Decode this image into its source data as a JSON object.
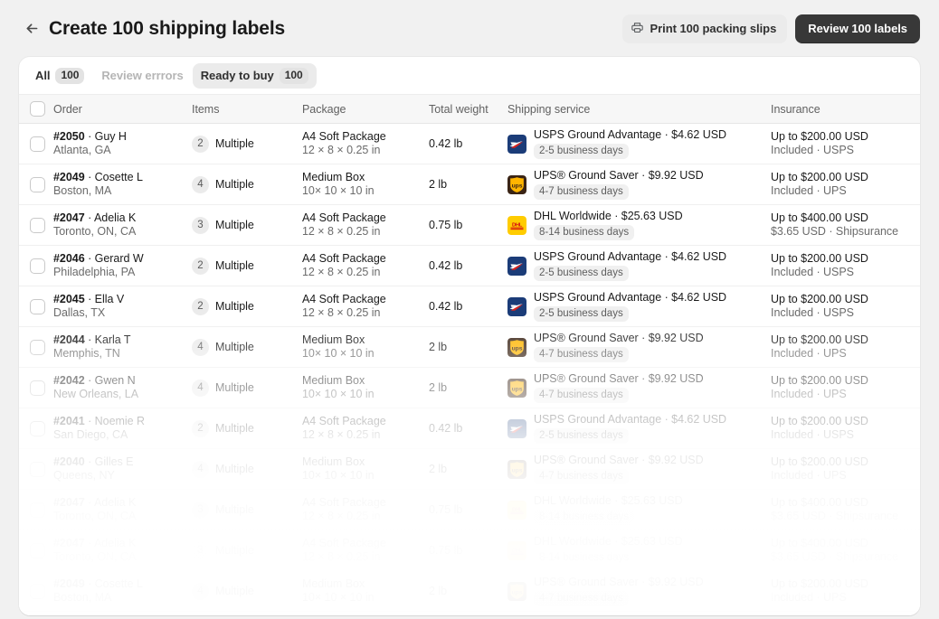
{
  "header": {
    "back_icon": "arrow-left-icon",
    "title": "Create 100 shipping labels",
    "print_label": "Print 100 packing slips",
    "print_icon": "printer-icon",
    "review_label": "Review 100 labels"
  },
  "tabs": [
    {
      "label": "All",
      "count": "100",
      "state": "default"
    },
    {
      "label": "Review errrors",
      "count": "",
      "state": "muted"
    },
    {
      "label": "Ready to buy",
      "count": "100",
      "state": "selected"
    }
  ],
  "table": {
    "columns": {
      "order": "Order",
      "items": "Items",
      "package": "Package",
      "weight": "Total weight",
      "service": "Shipping service",
      "insurance": "Insurance"
    },
    "rows": [
      {
        "order_id": "#2050",
        "customer": "Guy H",
        "location": "Atlanta, GA",
        "items_count": "2",
        "items_label": "Multiple",
        "package_name": "A4 Soft Package",
        "package_dims": "12 × 8 × 0.25 in",
        "weight": "0.42 lb",
        "carrier": "usps",
        "service": "USPS Ground Advantage · $4.62 USD",
        "days": "2-5 business days",
        "insurance_amount": "Up to $200.00 USD",
        "insurance_provider": "Included · USPS",
        "opacity": 1
      },
      {
        "order_id": "#2049",
        "customer": "Cosette L",
        "location": "Boston, MA",
        "items_count": "4",
        "items_label": "Multiple",
        "package_name": "Medium Box",
        "package_dims": "10× 10 × 10 in",
        "weight": "2 lb",
        "carrier": "ups",
        "service": "UPS® Ground Saver · $9.92 USD",
        "days": "4-7 business days",
        "insurance_amount": "Up to $200.00 USD",
        "insurance_provider": "Included · UPS",
        "opacity": 1
      },
      {
        "order_id": "#2047",
        "customer": "Adelia K",
        "location": "Toronto, ON, CA",
        "items_count": "3",
        "items_label": "Multiple",
        "package_name": "A4 Soft Package",
        "package_dims": "12 × 8 × 0.25 in",
        "weight": "0.75 lb",
        "carrier": "dhl",
        "service": "DHL Worldwide · $25.63 USD",
        "days": "8-14 business days",
        "insurance_amount": "Up to $400.00 USD",
        "insurance_provider": "$3.65 USD · Shipsurance",
        "opacity": 1
      },
      {
        "order_id": "#2046",
        "customer": "Gerard W",
        "location": "Philadelphia, PA",
        "items_count": "2",
        "items_label": "Multiple",
        "package_name": "A4 Soft Package",
        "package_dims": "12 × 8 × 0.25 in",
        "weight": "0.42 lb",
        "carrier": "usps",
        "service": "USPS Ground Advantage · $4.62 USD",
        "days": "2-5 business days",
        "insurance_amount": "Up to $200.00 USD",
        "insurance_provider": "Included · USPS",
        "opacity": 1
      },
      {
        "order_id": "#2045",
        "customer": "Ella V",
        "location": "Dallas, TX",
        "items_count": "2",
        "items_label": "Multiple",
        "package_name": "A4 Soft Package",
        "package_dims": "12 × 8 × 0.25 in",
        "weight": "0.42 lb",
        "carrier": "usps",
        "service": "USPS Ground Advantage · $4.62 USD",
        "days": "2-5 business days",
        "insurance_amount": "Up to $200.00 USD",
        "insurance_provider": "Included · USPS",
        "opacity": 1
      },
      {
        "order_id": "#2044",
        "customer": "Karla T",
        "location": "Memphis, TN",
        "items_count": "4",
        "items_label": "Multiple",
        "package_name": "Medium Box",
        "package_dims": "10× 10 × 10 in",
        "weight": "2 lb",
        "carrier": "ups",
        "service": "UPS® Ground Saver · $9.92 USD",
        "days": "4-7 business days",
        "insurance_amount": "Up to $200.00 USD",
        "insurance_provider": "Included · UPS",
        "opacity": 1
      },
      {
        "order_id": "#2042",
        "customer": "Gwen N",
        "location": "New Orleans, LA",
        "items_count": "4",
        "items_label": "Multiple",
        "package_name": "Medium Box",
        "package_dims": "10× 10 × 10 in",
        "weight": "2 lb",
        "carrier": "ups",
        "service": "UPS® Ground Saver · $9.92 USD",
        "days": "4-7 business days",
        "insurance_amount": "Up to $200.00 USD",
        "insurance_provider": "Included · UPS",
        "opacity": 1
      },
      {
        "order_id": "#2041",
        "customer": "Noemie R",
        "location": "San Diego, CA",
        "items_count": "2",
        "items_label": "Multiple",
        "package_name": "A4 Soft Package",
        "package_dims": "12 × 8 × 0.25 in",
        "weight": "0.42 lb",
        "carrier": "usps",
        "service": "USPS Ground Advantage · $4.62 USD",
        "days": "2-5 business days",
        "insurance_amount": "Up to $200.00 USD",
        "insurance_provider": "Included · USPS",
        "opacity": 1
      },
      {
        "order_id": "#2040",
        "customer": "Gilles E",
        "location": "Queens, NY",
        "items_count": "4",
        "items_label": "Multiple",
        "package_name": "Medium Box",
        "package_dims": "10× 10 × 10 in",
        "weight": "2 lb",
        "carrier": "ups",
        "service": "UPS® Ground Saver · $9.92 USD",
        "days": "4-7 business days",
        "insurance_amount": "Up to $200.00 USD",
        "insurance_provider": "Included · UPS",
        "opacity": 1
      },
      {
        "order_id": "#2047",
        "customer": "Adelia K",
        "location": "Toronto, ON, CA",
        "items_count": "3",
        "items_label": "Multiple",
        "package_name": "A4 Soft Package",
        "package_dims": "12 × 8 × 0.25 in",
        "weight": "0.75 lb",
        "carrier": "dhl",
        "service": "DHL Worldwide · $25.63 USD",
        "days": "8-14 business days",
        "insurance_amount": "Up to $400.00 USD",
        "insurance_provider": "$3.65 USD · Shipsurance",
        "opacity": 1
      },
      {
        "order_id": "#2047",
        "customer": "Adelia K",
        "location": "Toronto, ON, CA",
        "items_count": "3",
        "items_label": "Multiple",
        "package_name": "A4 Soft Package",
        "package_dims": "12 × 8 × 0.25 in",
        "weight": "0.75 lb",
        "carrier": "dhl",
        "service": "DHL Worldwide · $25.63 USD",
        "days": "8-14 business days",
        "insurance_amount": "Up to $400.00 USD",
        "insurance_provider": "$3.65 USD · Shipsurance",
        "opacity": 1
      },
      {
        "order_id": "#2049",
        "customer": "Cosette L",
        "location": "Boston, MA",
        "items_count": "4",
        "items_label": "Multiple",
        "package_name": "Medium Box",
        "package_dims": "10× 10 × 10 in",
        "weight": "2 lb",
        "carrier": "ups",
        "service": "UPS® Ground Saver · $9.92 USD",
        "days": "4-7 business days",
        "insurance_amount": "Up to $200.00 USD",
        "insurance_provider": "Included · UPS",
        "opacity": 1
      }
    ]
  },
  "colors": {
    "page_bg": "#f1f1f1",
    "card_bg": "#ffffff",
    "primary_button": "#383838",
    "secondary_button": "#ebebeb",
    "usps_blue": "#1b3c78",
    "ups_brown": "#4b2e12",
    "ups_gold": "#ffb500",
    "dhl_yellow": "#ffcc00",
    "dhl_red": "#d40511"
  }
}
